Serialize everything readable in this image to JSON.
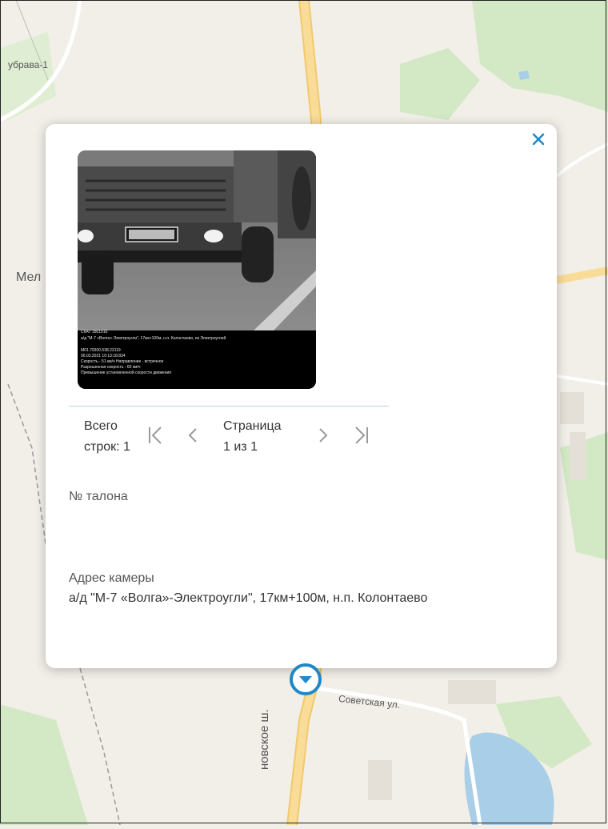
{
  "map": {
    "labels": {
      "dubrava": "убрава-1",
      "mel": "Мел",
      "sovetskaya": "Советская ул.",
      "shosse": "новское ш."
    }
  },
  "popup": {
    "close_icon": "close-icon",
    "photo": {
      "overlay_lines": [
        "СКАТ 1801016",
        "а/д \"М-7 «Волга»-Электроугли\", 17км+100м, н.п. Колонтаево, из Электроуглей",
        "",
        "М01.79300.538.23119",
        "06.03.2021 10:13:18.834",
        "Скорость - 51 км/ч Направление - встречное",
        "Разрешенная скорость - 60 км/ч",
        "Превышение установленной скорости движения"
      ]
    },
    "pager": {
      "total_label_1": "Всего",
      "total_label_2": "строк: 1",
      "page_label_1": "Страница",
      "page_label_2": "1 из 1"
    },
    "ticket_label": "№ талона",
    "camera_address_label": "Адрес камеры",
    "camera_address_value": "а/д \"М-7 «Волга»-Электроугли\", 17км+100м, н.п. Колонтаево"
  },
  "colors": {
    "accent": "#1e88c8",
    "road_yellow": "#f7d98e",
    "water": "#a9cfe8",
    "green": "#cfe6c0"
  }
}
